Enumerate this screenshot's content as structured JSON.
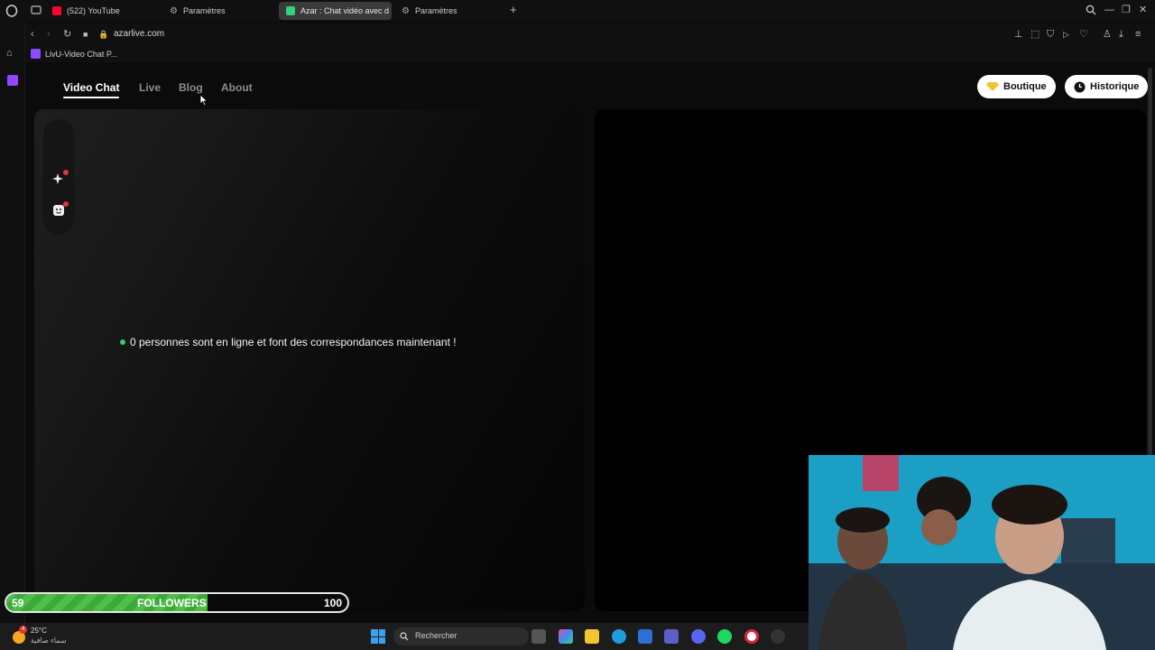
{
  "browser": {
    "tabs": [
      {
        "label": "(522) YouTube",
        "icon": "youtube-icon",
        "color": "#ff0033"
      },
      {
        "label": "Paramètres",
        "icon": "gear-icon",
        "color": "#9a9a9a"
      },
      {
        "label": "Azar : Chat vidéo avec d",
        "icon": "azar-icon",
        "color": "#33d17a"
      },
      {
        "label": "Paramètres",
        "icon": "gear-icon",
        "color": "#9a9a9a"
      }
    ],
    "url": "azarlive.com",
    "bookmark": "LivU-Video Chat P..."
  },
  "site": {
    "nav": [
      {
        "label": "Video Chat",
        "active": true
      },
      {
        "label": "Live",
        "active": false
      },
      {
        "label": "Blog",
        "active": false
      },
      {
        "label": "About",
        "active": false
      }
    ],
    "boutique_label": "Boutique",
    "historique_label": "Historique",
    "online_text": "0 personnes sont en ligne et font des correspondances maintenant !",
    "colors": {
      "online_dot": "#2ecc71",
      "badge": "#e0304a",
      "gem": "#f4c430"
    }
  },
  "overlay": {
    "followers": {
      "current": "59",
      "label": "FOLLOWERS",
      "goal": "100",
      "progress": 0.59
    }
  },
  "taskbar": {
    "weather": {
      "temp": "25°C",
      "desc": "سماء صافية",
      "badge": "4"
    },
    "search_placeholder": "Rechercher"
  }
}
